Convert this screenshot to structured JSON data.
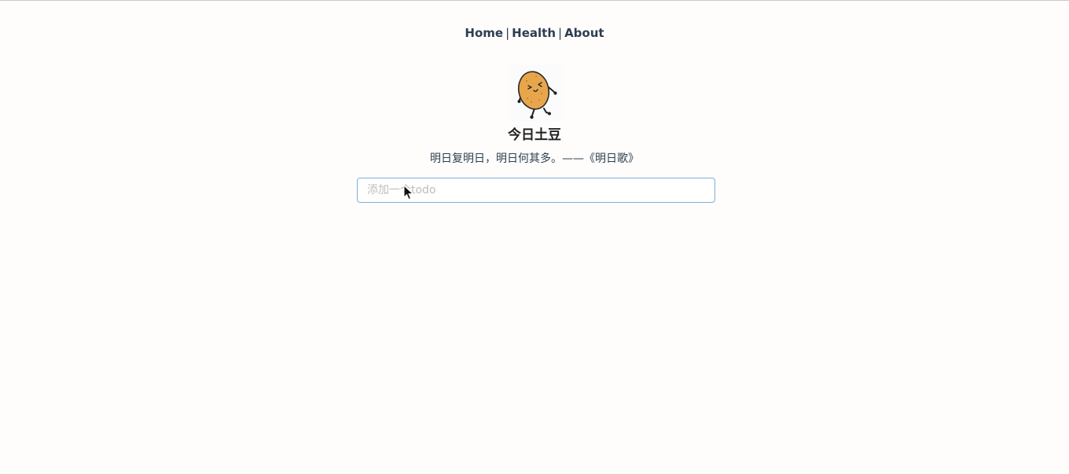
{
  "nav": {
    "items": [
      {
        "label": "Home"
      },
      {
        "label": "Health"
      },
      {
        "label": "About"
      }
    ],
    "separator": "|"
  },
  "logo": {
    "icon": "potato-mascot-icon"
  },
  "header": {
    "title": "今日土豆",
    "quote": "明日复明日，明日何其多。——《明日歌》"
  },
  "todo": {
    "placeholder": "添加一个todo",
    "value": ""
  },
  "colors": {
    "background": "#fffdfc",
    "text": "#2c3e50",
    "input_border": "#7fb0d6",
    "potato": "#e8a64c"
  }
}
